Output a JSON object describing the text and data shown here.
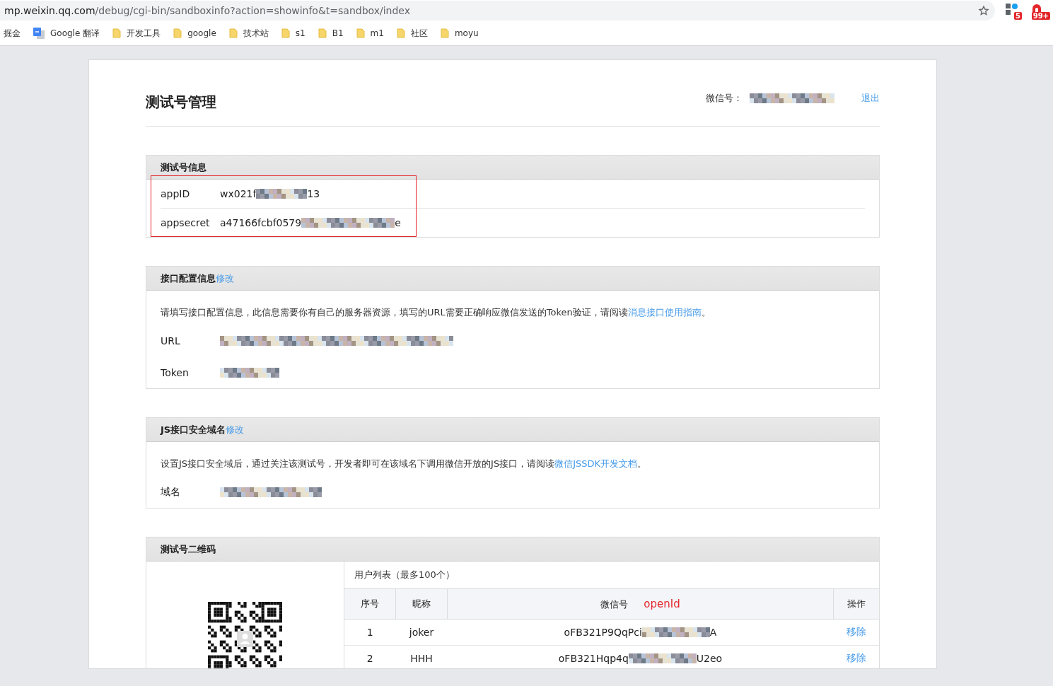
{
  "browser": {
    "url_host": "mp.weixin.qq.com",
    "url_path": "/debug/cgi-bin/sandboxinfo?action=showinfo&t=sandbox/index",
    "extension_badges": [
      "5",
      "99+"
    ],
    "bookmarks": [
      {
        "label": "掘金",
        "kind": "text"
      },
      {
        "label": "Google 翻译",
        "kind": "translate"
      },
      {
        "label": "开发工具",
        "kind": "folder"
      },
      {
        "label": "google",
        "kind": "folder"
      },
      {
        "label": "技术站",
        "kind": "folder"
      },
      {
        "label": "s1",
        "kind": "folder"
      },
      {
        "label": "B1",
        "kind": "folder"
      },
      {
        "label": "m1",
        "kind": "folder"
      },
      {
        "label": "社区",
        "kind": "folder"
      },
      {
        "label": "moyu",
        "kind": "folder"
      }
    ]
  },
  "page": {
    "title": "测试号管理",
    "account_label": "微信号：",
    "logout": "退出"
  },
  "test_info": {
    "title": "测试号信息",
    "rows": [
      {
        "label": "appID",
        "prefix": "wx021f",
        "suffix": "13"
      },
      {
        "label": "appsecret",
        "prefix": "a47166fcbf0579",
        "suffix": "e"
      }
    ]
  },
  "interface_config": {
    "title": "接口配置信息",
    "edit": "修改",
    "note": "请填写接口配置信息，此信息需要你有自己的服务器资源，填写的URL需要正确响应微信发送的Token验证，请阅读",
    "link": "消息接口使用指南",
    "note_end": "。",
    "rows": [
      {
        "label": "URL",
        "prefix": "",
        "suffix": ""
      },
      {
        "label": "Token",
        "prefix": "",
        "suffix": ""
      }
    ]
  },
  "js_domain": {
    "title": "JS接口安全域名",
    "edit": "修改",
    "note": "设置JS接口安全域后，通过关注该测试号，开发者即可在该域名下调用微信开放的JS接口，请阅读",
    "link": "微信JSSDK开发文档",
    "note_end": "。",
    "rows": [
      {
        "label": "域名",
        "prefix": "",
        "suffix": ""
      }
    ]
  },
  "qr_section": {
    "title": "测试号二维码",
    "user_list_title": "用户列表（最多100个）",
    "columns": [
      "序号",
      "昵称",
      "微信号",
      "操作"
    ],
    "column_note": "openId",
    "users": [
      {
        "index": "1",
        "nickname": "joker",
        "prefix": "oFB321P9QqPci",
        "suffix": "A",
        "action": "移除"
      },
      {
        "index": "2",
        "nickname": "HHH",
        "prefix": "oFB321Hqp4q",
        "suffix": "U2eo",
        "action": "移除"
      }
    ]
  }
}
